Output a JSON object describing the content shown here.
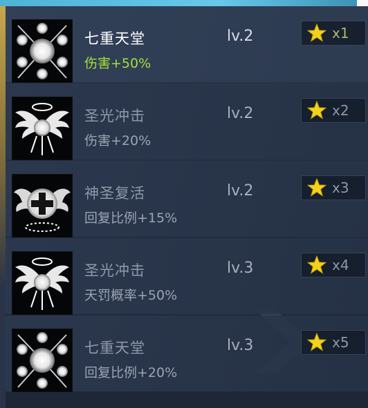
{
  "skills": [
    {
      "name": "七重天堂",
      "effect": "伤害+50%",
      "level": "lv.2",
      "stars": "x1",
      "icon": "seven-orbs-icon"
    },
    {
      "name": "圣光冲击",
      "effect": "伤害+20%",
      "level": "lv.2",
      "stars": "x2",
      "icon": "winged-orb-icon"
    },
    {
      "name": "神圣复活",
      "effect": "回复比例+15%",
      "level": "lv.2",
      "stars": "x3",
      "icon": "winged-cross-icon"
    },
    {
      "name": "圣光冲击",
      "effect": "天罚概率+50%",
      "level": "lv.3",
      "stars": "x4",
      "icon": "winged-orb-icon"
    },
    {
      "name": "七重天堂",
      "effect": "回复比例+20%",
      "level": "lv.3",
      "stars": "x5",
      "icon": "seven-orbs-icon"
    }
  ],
  "colors": {
    "highlight_effect": "#a8e03a",
    "star": "#f2d21c",
    "panel": "#28344a"
  }
}
